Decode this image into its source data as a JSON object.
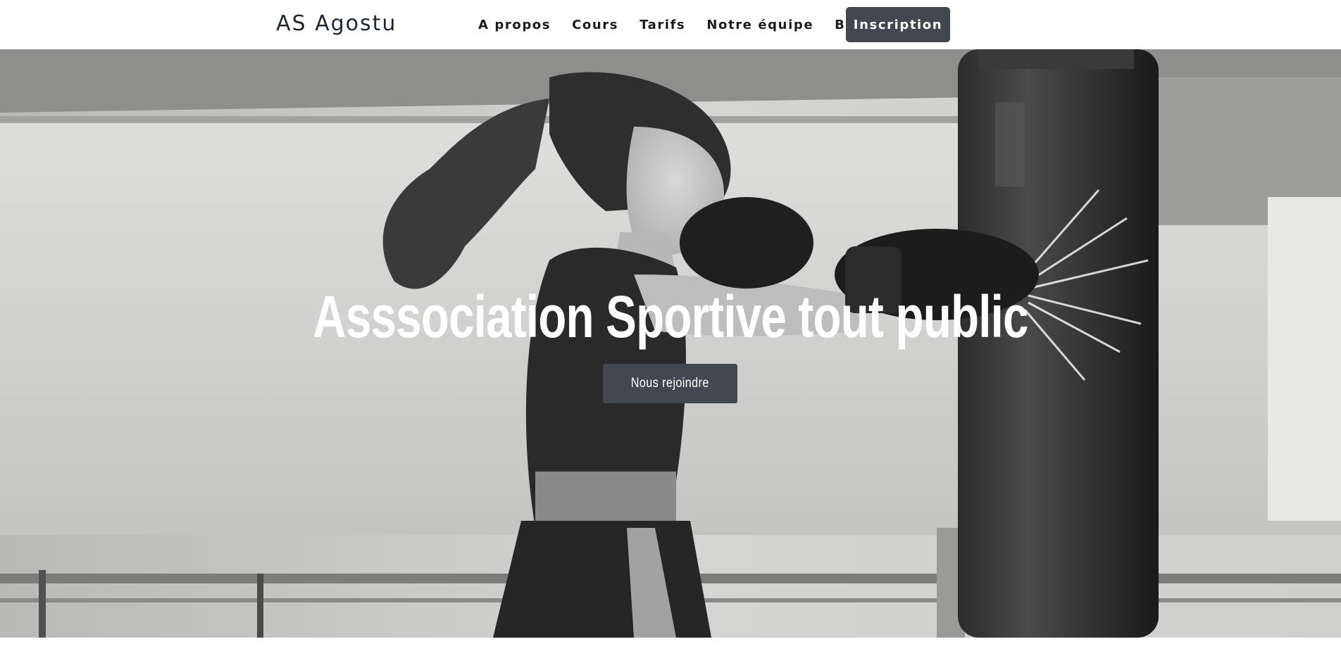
{
  "header": {
    "brand": "AS Agostu",
    "nav": [
      {
        "label": "A propos"
      },
      {
        "label": "Cours"
      },
      {
        "label": "Tarifs"
      },
      {
        "label": "Notre équipe"
      },
      {
        "label": "Blog"
      }
    ],
    "cta_label": "Inscription"
  },
  "hero": {
    "title": "Asssociation Sportive tout public",
    "button_label": "Nous rejoindre"
  },
  "colors": {
    "button_bg": "#434750",
    "brand_text": "#1e2533"
  }
}
